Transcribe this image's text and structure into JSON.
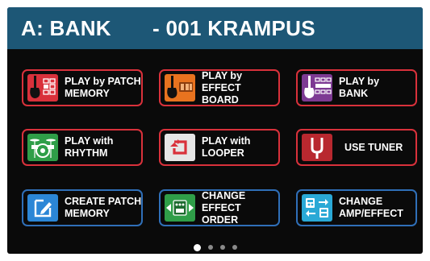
{
  "header": {
    "bank": "A: BANK",
    "patch": "- 001 KRAMPUS",
    "color": "#1d5776"
  },
  "menu": [
    {
      "label": "PLAY by PATCH\nMEMORY",
      "icon": "guitar-patch-memory-icon",
      "icon_color": "#d9313b",
      "border": "#d9313b"
    },
    {
      "label": "PLAY by\nEFFECT BOARD",
      "icon": "guitar-effect-board-icon",
      "icon_color": "#e8731f",
      "border": "#d9313b"
    },
    {
      "label": "PLAY by\nBANK",
      "icon": "guitar-bank-icon",
      "icon_color": "#7d3a93",
      "border": "#d9313b"
    },
    {
      "label": "PLAY with\nRHYTHM",
      "icon": "drum-kit-icon",
      "icon_color": "#2f9e48",
      "border": "#d9313b"
    },
    {
      "label": "PLAY with\nLOOPER",
      "icon": "looper-icon",
      "icon_color": "#e6e6e6",
      "border": "#d9313b"
    },
    {
      "label": "USE TUNER",
      "icon": "tuning-fork-icon",
      "icon_color": "#b8282f",
      "border": "#d9313b"
    },
    {
      "label": "CREATE PATCH\nMEMORY",
      "icon": "edit-pencil-icon",
      "icon_color": "#2b86d6",
      "border": "#2f6fb8"
    },
    {
      "label": "CHANGE\nEFFECT ORDER",
      "icon": "effect-order-icon",
      "icon_color": "#2f9e48",
      "border": "#2f6fb8"
    },
    {
      "label": "CHANGE\nAMP/EFFECT",
      "icon": "amp-effect-swap-icon",
      "icon_color": "#2aa9d6",
      "border": "#2f6fb8"
    }
  ],
  "pagination": {
    "pages": 4,
    "current": 1
  }
}
